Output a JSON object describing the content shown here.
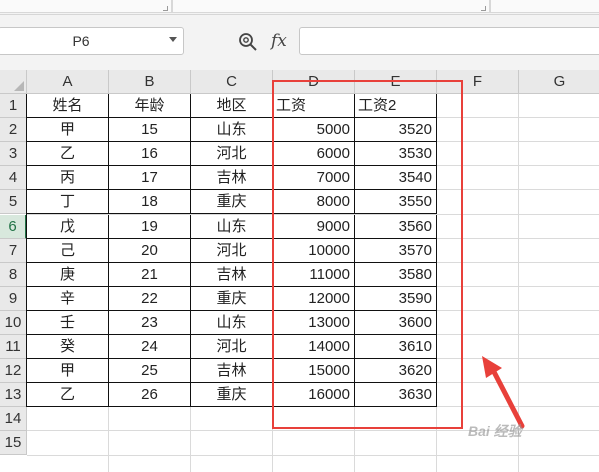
{
  "namebox": {
    "value": "P6"
  },
  "formula": {
    "fx_label": "fx",
    "value": ""
  },
  "columns": [
    "A",
    "B",
    "C",
    "D",
    "E",
    "F",
    "G"
  ],
  "rows": [
    "1",
    "2",
    "3",
    "4",
    "5",
    "6",
    "7",
    "8",
    "9",
    "10",
    "11",
    "12",
    "13",
    "14",
    "15"
  ],
  "active_row": "6",
  "table": {
    "headers": [
      "姓名",
      "年龄",
      "地区",
      "工资",
      "工资2"
    ],
    "records": [
      [
        "甲",
        "15",
        "山东",
        "5000",
        "3520"
      ],
      [
        "乙",
        "16",
        "河北",
        "6000",
        "3530"
      ],
      [
        "丙",
        "17",
        "吉林",
        "7000",
        "3540"
      ],
      [
        "丁",
        "18",
        "重庆",
        "8000",
        "3550"
      ],
      [
        "戊",
        "19",
        "山东",
        "9000",
        "3560"
      ],
      [
        "己",
        "20",
        "河北",
        "10000",
        "3570"
      ],
      [
        "庚",
        "21",
        "吉林",
        "11000",
        "3580"
      ],
      [
        "辛",
        "22",
        "重庆",
        "12000",
        "3590"
      ],
      [
        "壬",
        "23",
        "山东",
        "13000",
        "3600"
      ],
      [
        "癸",
        "24",
        "河北",
        "14000",
        "3610"
      ],
      [
        "甲",
        "25",
        "吉林",
        "15000",
        "3620"
      ],
      [
        "乙",
        "26",
        "重庆",
        "16000",
        "3630"
      ]
    ]
  },
  "annotation": {
    "color": "#e8403a"
  },
  "watermark": {
    "text": "Bai 经验"
  },
  "icons": {
    "zoom": "zoom-formula-icon",
    "dropdown": "chevron-down-icon"
  }
}
